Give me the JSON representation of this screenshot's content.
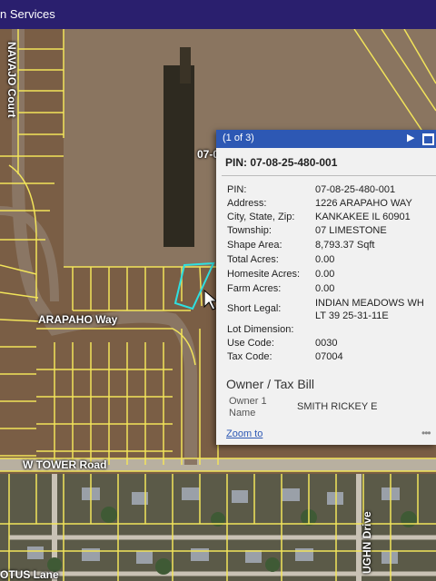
{
  "header": {
    "title": "n Services"
  },
  "map": {
    "labels": {
      "navajo": "NAVAJO Court",
      "arapaho": "ARAPAHO Way",
      "tower": "W TOWER Road",
      "lotus": "OTUS Lane",
      "drive": "UGHN Drive",
      "parcel_tag": "07-0"
    }
  },
  "popup": {
    "counter": "(1 of 3)",
    "next_icon": "▶",
    "title": "PIN: 07-08-25-480-001",
    "attributes": [
      {
        "label": "PIN:",
        "value": "07-08-25-480-001"
      },
      {
        "label": "Address:",
        "value": "1226 ARAPAHO WAY"
      },
      {
        "label": "City, State, Zip:",
        "value": "KANKAKEE IL 60901"
      },
      {
        "label": "Township:",
        "value": "07  LIMESTONE"
      },
      {
        "label": "Shape Area:",
        "value": "8,793.37 Sqft"
      },
      {
        "label": "Total Acres:",
        "value": "0.00"
      },
      {
        "label": "Homesite Acres:",
        "value": "0.00"
      },
      {
        "label": "Farm Acres:",
        "value": "0.00"
      },
      {
        "label": "Short Legal:",
        "value": "INDIAN MEADOWS WH LT 39 25-31-11E"
      },
      {
        "label": "Lot Dimension:",
        "value": ""
      },
      {
        "label": "Use Code:",
        "value": "0030"
      },
      {
        "label": "Tax Code:",
        "value": "07004"
      }
    ],
    "owner_section_title": "Owner / Tax Bill",
    "owner_label": "Owner 1 Name",
    "owner_value": "SMITH RICKEY E",
    "zoom_link": "Zoom to",
    "more_icon": "•••"
  }
}
